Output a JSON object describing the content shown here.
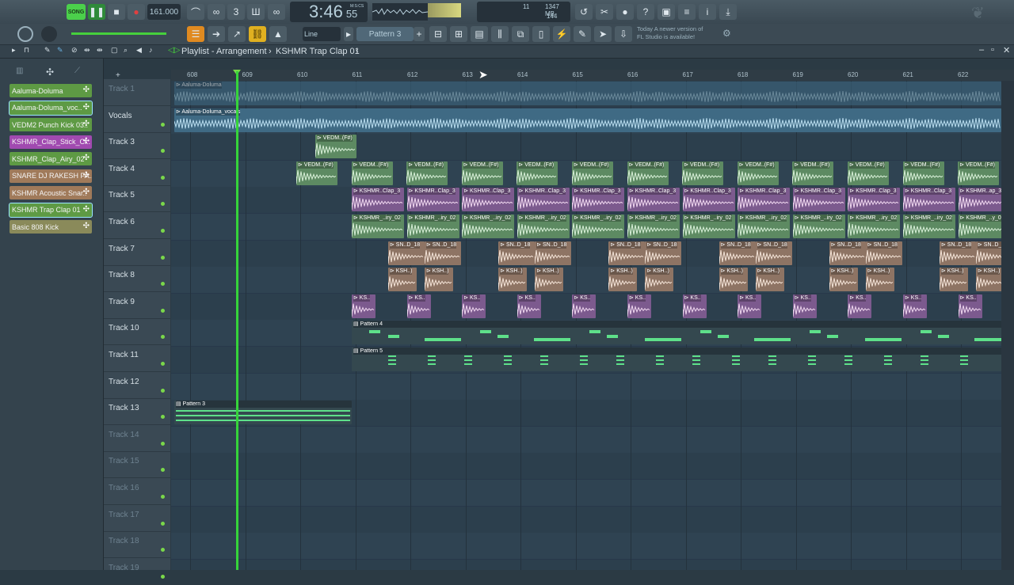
{
  "transport": {
    "mode": "SONG",
    "tempo": "161.000",
    "time": "3:46",
    "time_sub": "55",
    "time_unit": "M:S:CS",
    "cpu": "11",
    "memory": "1347 MB",
    "polyphony": "144"
  },
  "toolbar2": {
    "snap": "Line",
    "pattern": "Pattern 3",
    "news_line1": "Today",
    "news_line2": "A newer version of",
    "news_line3": "FL Studio is available!"
  },
  "window": {
    "title": "Playlist - Arrangement",
    "pattern_name": "KSHMR Trap Clap 01"
  },
  "channels": [
    {
      "name": "Aaluma-Doluma",
      "color": "#5e9a44"
    },
    {
      "name": "Aaluma-Doluma_voc..",
      "color": "#5e9a44"
    },
    {
      "name": "VEDM2 Punch Kick 03..",
      "color": "#5e9a44"
    },
    {
      "name": "KSHMR_Clap_Stick_Cl..",
      "color": "#a14ab0"
    },
    {
      "name": "KSHMR_Clap_Airy_02",
      "color": "#5e9a44"
    },
    {
      "name": "SNARE DJ RAKESH FA..",
      "color": "#a07a5a"
    },
    {
      "name": "KSHMR Acoustic Snar..",
      "color": "#a07a5a"
    },
    {
      "name": "KSHMR Trap Clap 01",
      "color": "#5e9a44"
    },
    {
      "name": "Basic 808 Kick",
      "color": "#8a8a5a"
    }
  ],
  "ruler": [
    "608",
    "609",
    "610",
    "611",
    "612",
    "613",
    "614",
    "615",
    "616",
    "617",
    "618",
    "619",
    "620",
    "621",
    "622"
  ],
  "tracks": [
    {
      "name": "Track 1",
      "dim": true
    },
    {
      "name": "Vocals",
      "dim": false
    },
    {
      "name": "Track 3",
      "dim": false
    },
    {
      "name": "Track 4",
      "dim": false
    },
    {
      "name": "Track 5",
      "dim": false
    },
    {
      "name": "Track 6",
      "dim": false
    },
    {
      "name": "Track 7",
      "dim": false
    },
    {
      "name": "Track 8",
      "dim": false
    },
    {
      "name": "Track 9",
      "dim": false
    },
    {
      "name": "Track 10",
      "dim": false
    },
    {
      "name": "Track 11",
      "dim": false
    },
    {
      "name": "Track 12",
      "dim": false
    },
    {
      "name": "Track 13",
      "dim": false
    },
    {
      "name": "Track 14",
      "dim": true
    },
    {
      "name": "Track 15",
      "dim": true
    },
    {
      "name": "Track 16",
      "dim": true
    },
    {
      "name": "Track 17",
      "dim": true
    },
    {
      "name": "Track 18",
      "dim": true
    },
    {
      "name": "Track 19",
      "dim": true
    }
  ],
  "clip_labels": {
    "audio_main": "Aaluma-Doluma",
    "audio_vocals": "Aaluma-Doluma_vocals",
    "kick": "VEDM..(F#)",
    "clap3": "KSHMR..Clap_3",
    "clap3_last": "KSHMR..ap_3",
    "airy": "KSHMR_..iry_02",
    "airy_last": "KSHMR_..y_02",
    "snare": "SN..D_18",
    "snare_short": "S..18",
    "acoustic": "KSH..)",
    "trapclap": "KS..",
    "pattern4": "Pattern 4",
    "pattern5": "Pattern 5",
    "pattern3": "Pattern 3"
  },
  "colors": {
    "green_clip": "#5d8a62",
    "purple_clip": "#7c5a8e",
    "tan_clip": "#8e7464",
    "audio_bg": "#3f6a84",
    "pattern_bg": "#34484f",
    "playhead": "#36d43a"
  }
}
